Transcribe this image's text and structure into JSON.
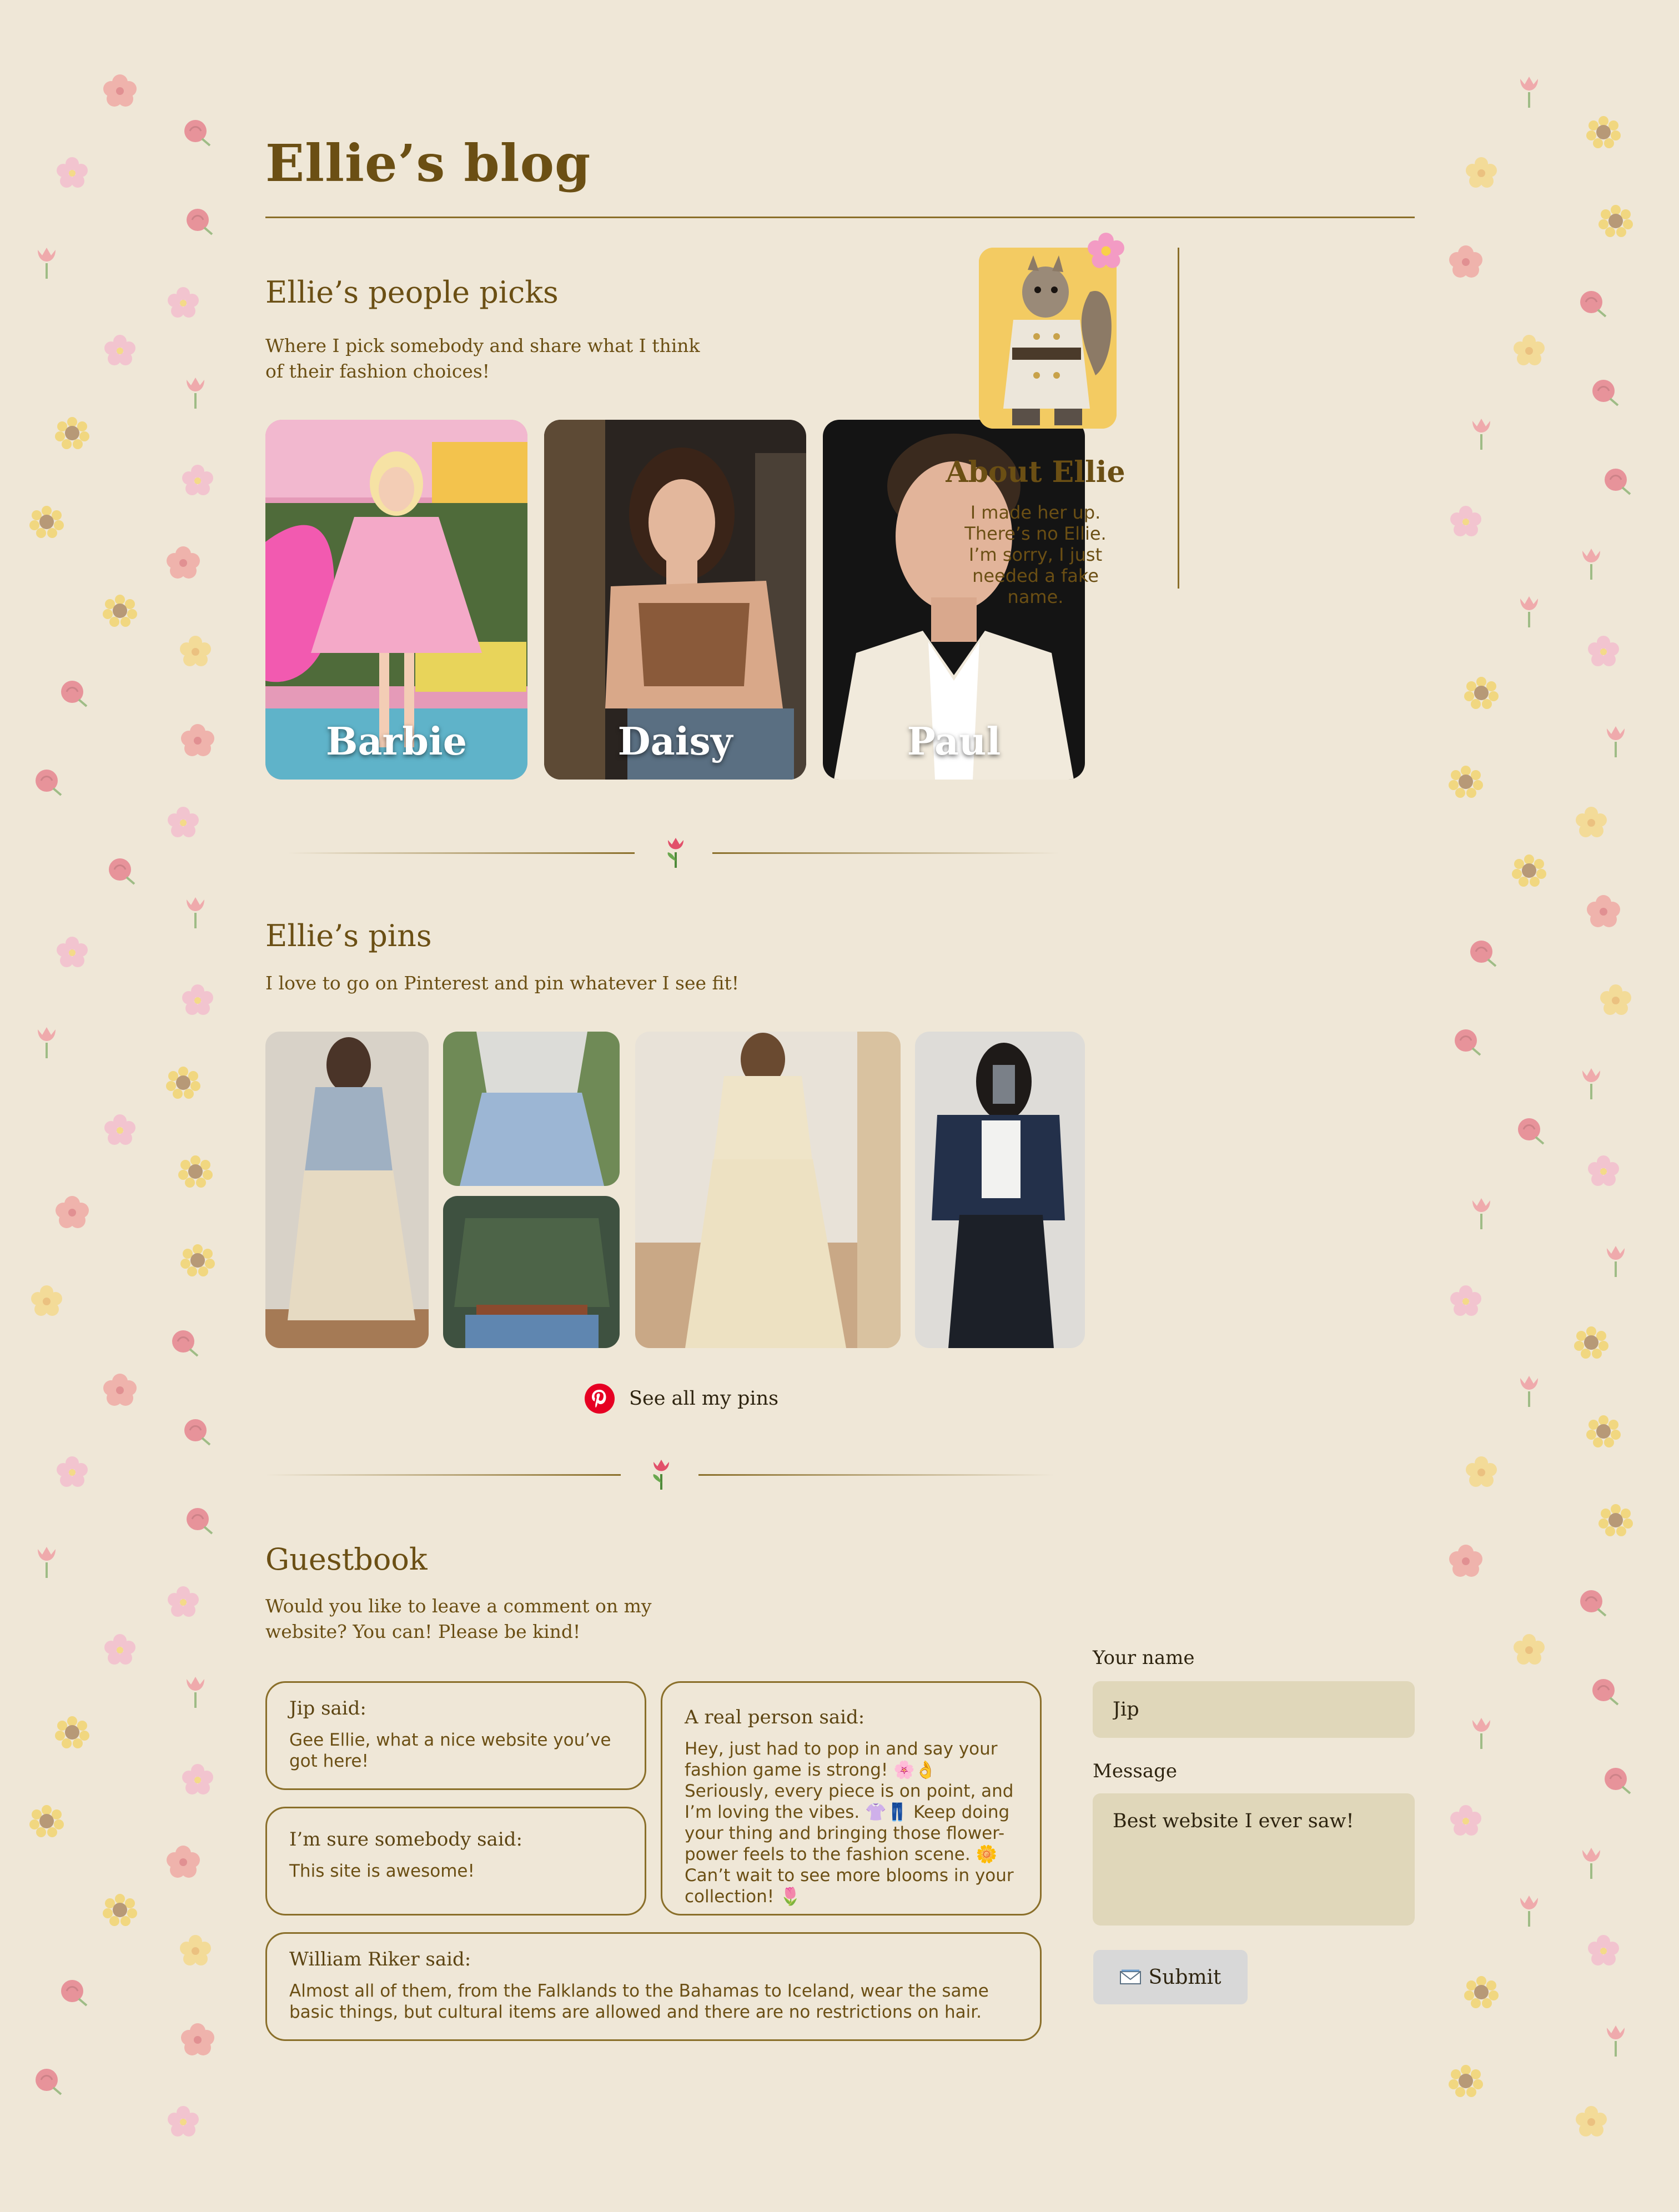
{
  "site": {
    "title": "Ellie’s blog"
  },
  "people_picks": {
    "title": "Ellie’s people picks",
    "description": "Where I pick somebody and share what I think of their fashion choices!",
    "people": [
      {
        "name": "Barbie"
      },
      {
        "name": "Daisy"
      },
      {
        "name": "Paul"
      }
    ]
  },
  "sidebar": {
    "about_title": "About Ellie",
    "about_text": "I made her up. There’s no Ellie. I’m sorry, I just needed a fake name."
  },
  "pins": {
    "title": "Ellie’s pins",
    "description": "I love to go on Pinterest and pin whatever I see fit!",
    "see_all_label": "See all my pins"
  },
  "guestbook": {
    "title": "Guestbook",
    "description": "Would you like to leave a comment on my website? You can! Please be kind!",
    "entries": [
      {
        "author": "Jip said:",
        "text": "Gee Ellie, what a nice website you’ve got here!"
      },
      {
        "author": "I’m sure somebody said:",
        "text": "This site is awesome!"
      },
      {
        "author": "A real person said:",
        "text": "Hey, just had to pop in and say your fashion game is strong! 🌸👌 Seriously, every piece is on point, and I’m loving the vibes. 👚👖 Keep doing your thing and bringing those flower-power feels to the fashion scene. 🌼 Can’t wait to see more blooms in your collection! 🌷"
      },
      {
        "author": "William Riker said:",
        "text": "Almost all of them, from the Falklands to the Bahamas to Iceland, wear the same basic things, but cultural items are allowed and there are no restrictions on hair."
      }
    ],
    "form": {
      "name_label": "Your name",
      "name_value": "Jip",
      "message_label": "Message",
      "message_value": "Best website I ever saw!",
      "submit_label": "Submit"
    }
  },
  "colors": {
    "background": "#efe7d7",
    "text_brown": "#6b4f14",
    "rule_brown": "#8a6f2a",
    "input_bg": "#e0d7ba",
    "button_bg": "#d8d8d8",
    "avatar_bg": "#f3cb62",
    "pinterest_red": "#e60023"
  },
  "icons": {
    "divider": "tulip-icon",
    "avatar_badge": "cherry-blossom-icon",
    "pins_link": "pinterest-icon",
    "submit": "envelope-icon",
    "background_pattern": [
      "hibiscus-icon",
      "rose-icon",
      "cherry-blossom-icon",
      "sunflower-icon",
      "blossom-icon",
      "tulip-icon"
    ]
  }
}
